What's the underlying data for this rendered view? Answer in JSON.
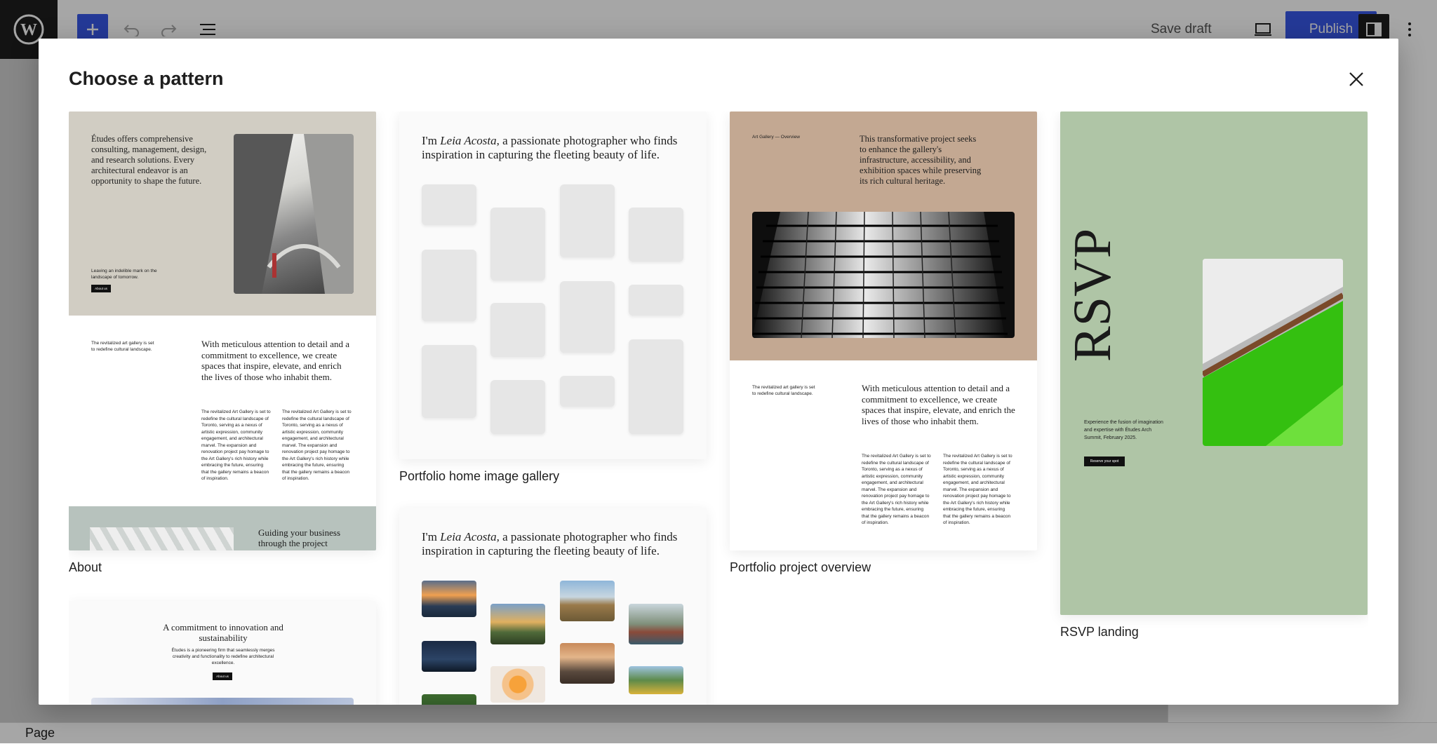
{
  "topbar": {
    "save_draft": "Save draft",
    "publish": "Publish"
  },
  "statusbar": {
    "label": "Page"
  },
  "modal": {
    "title": "Choose a pattern",
    "close_icon": "close-icon"
  },
  "patterns": [
    {
      "caption": "About",
      "hero_text": "Études offers comprehensive consulting, management, design, and research solutions. Every architectural endeavor is an opportunity to shape the future.",
      "small_text": "Leaving an indelible mark on the landscape of tomorrow.",
      "button": "About us",
      "side_note": "The revitalized art gallery is set to redefine cultural landscape.",
      "heading": "With meticulous attention to detail and a commitment to excellence, we create spaces that inspire, elevate, and enrich the lives of those who inhabit them.",
      "col1": "The revitalized Art Gallery is set to redefine the cultural landscape of Toronto, serving as a nexus of artistic expression, community engagement, and architectural marvel. The expansion and renovation project pay homage to the Art Gallery's rich history while embracing the future, ensuring that the gallery remains a beacon of inspiration.",
      "col2": "The revitalized Art Gallery is set to redefine the cultural landscape of Toronto, serving as a nexus of artistic expression, community engagement, and architectural marvel. The expansion and renovation project pay homage to the Art Gallery's rich history while embracing the future, ensuring that the gallery remains a beacon of inspiration.",
      "bottom_heading": "Guiding your business through the project"
    },
    {
      "caption": "Portfolio home image gallery",
      "intro_pre": "I'm ",
      "intro_name": "Leia Acosta",
      "intro_post": ", a passionate photographer who finds inspiration in capturing the fleeting beauty of life."
    },
    {
      "caption": "Portfolio project overview",
      "eyebrow": "Art Gallery — Overview",
      "hero_text": "This transformative project seeks to enhance the gallery's infrastructure, accessibility, and exhibition spaces while preserving its rich cultural heritage.",
      "side_note": "The revitalized art gallery is set to redefine cultural landscape.",
      "heading": "With meticulous attention to detail and a commitment to excellence, we create spaces that inspire, elevate, and enrich the lives of those who inhabit them.",
      "col1": "The revitalized Art Gallery is set to redefine the cultural landscape of Toronto, serving as a nexus of artistic expression, community engagement, and architectural marvel. The expansion and renovation project pay homage to the Art Gallery's rich history while embracing the future, ensuring that the gallery remains a beacon of inspiration.",
      "col2": "The revitalized Art Gallery is set to redefine the cultural landscape of Toronto, serving as a nexus of artistic expression, community engagement, and architectural marvel. The expansion and renovation project pay homage to the Art Gallery's rich history while embracing the future, ensuring that the gallery remains a beacon of inspiration."
    },
    {
      "caption": "RSVP landing",
      "big_word": "RSVP",
      "text": "Experience the fusion of imagination and expertise with Études Arch Summit, February 2025.",
      "button": "Reserve your spot"
    },
    {
      "caption": "",
      "intro_pre": "I'm ",
      "intro_name": "Leia Acosta",
      "intro_post": ", a passionate photographer who finds inspiration in capturing the fleeting beauty of life."
    },
    {
      "caption": "",
      "heading": "A commitment to innovation and sustainability",
      "text": "Études is a pioneering firm that seamlessly merges creativity and functionality to redefine architectural excellence.",
      "button": "About us"
    }
  ],
  "colors": {
    "accent": "#3858e9",
    "about_bg": "#d1cdc3",
    "overview_bg": "#c3a892",
    "rsvp_bg": "#afc5a6",
    "about_bottom_bg": "#b7c2bd"
  }
}
